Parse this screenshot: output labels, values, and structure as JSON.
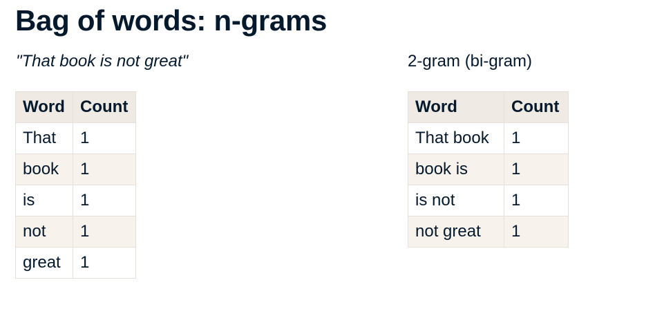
{
  "slide": {
    "title": "Bag of words: n-grams",
    "sentence": "\"That book is not great\"",
    "bigram_caption": "2-gram (bi-gram)"
  },
  "unigram_table": {
    "headers": [
      "Word",
      "Count"
    ],
    "rows": [
      [
        "That",
        "1"
      ],
      [
        "book",
        "1"
      ],
      [
        "is",
        "1"
      ],
      [
        "not",
        "1"
      ],
      [
        "great",
        "1"
      ]
    ]
  },
  "bigram_table": {
    "headers": [
      "Word",
      "Count"
    ],
    "rows": [
      [
        "That book",
        "1"
      ],
      [
        "book is",
        "1"
      ],
      [
        "is not",
        "1"
      ],
      [
        "not great",
        "1"
      ]
    ]
  }
}
